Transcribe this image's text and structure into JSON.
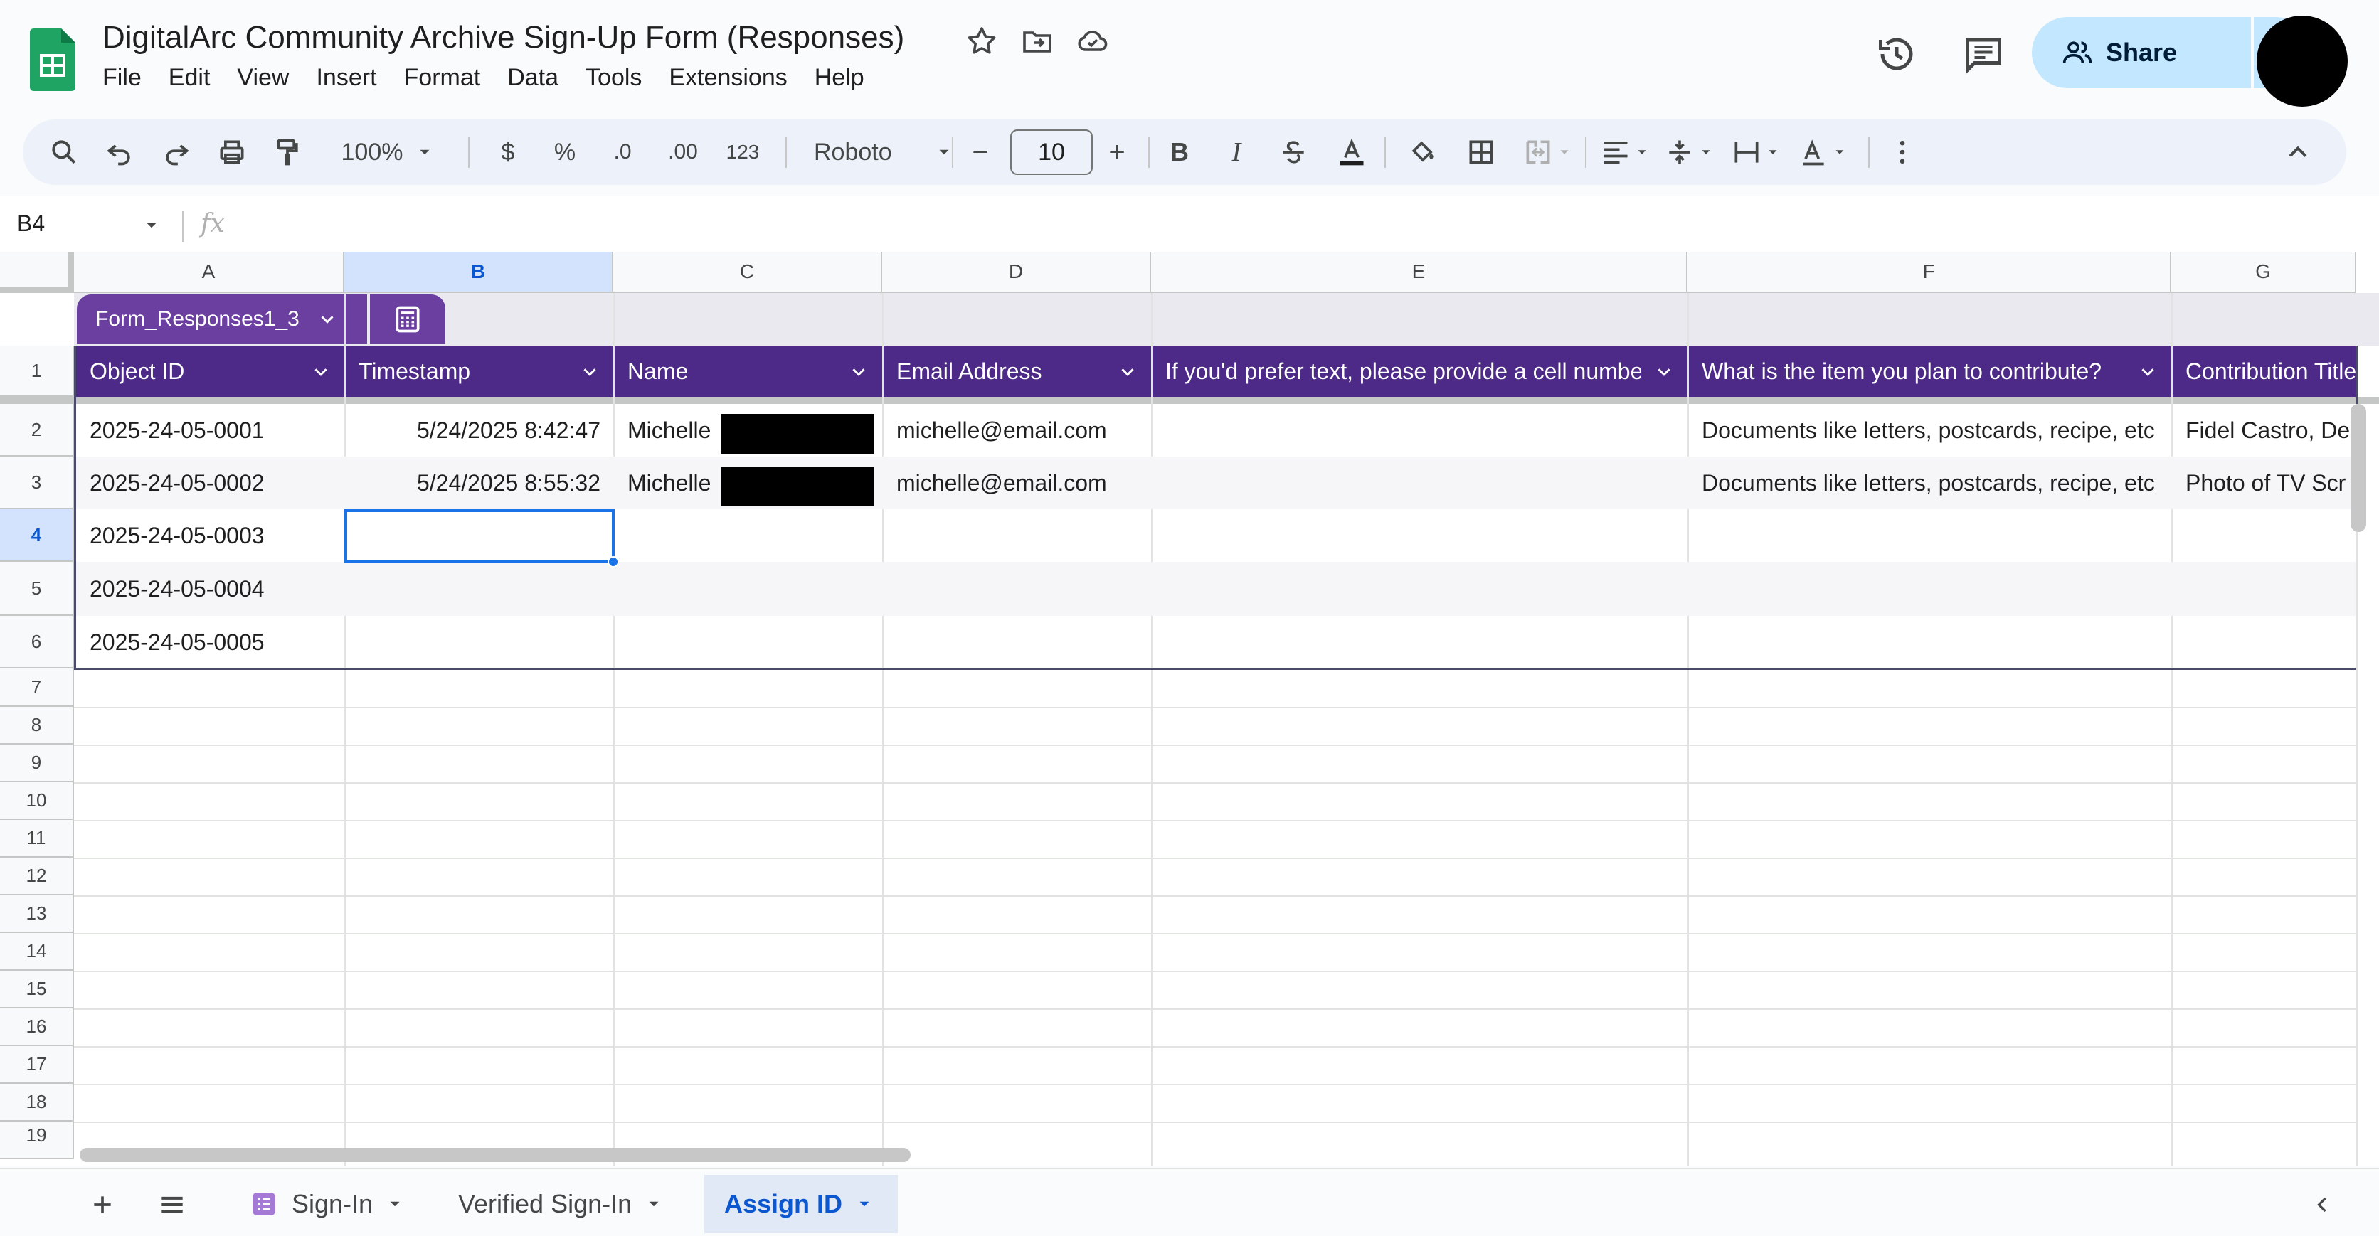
{
  "doc": {
    "title": "DigitalArc Community Archive Sign-Up Form  (Responses)",
    "menu": [
      "File",
      "Edit",
      "View",
      "Insert",
      "Format",
      "Data",
      "Tools",
      "Extensions",
      "Help"
    ],
    "share_label": "Share"
  },
  "toolbar": {
    "zoom": "100%",
    "currency": "$",
    "percent": "%",
    "dec_decrease": ".0",
    "dec_increase": ".00",
    "number_format": "123",
    "font": "Roboto",
    "font_size": "10",
    "minus": "−",
    "plus": "+",
    "bold": "B",
    "italic": "I"
  },
  "formula": {
    "cell_ref": "B4",
    "fx": "fx"
  },
  "columns": [
    "A",
    "B",
    "C",
    "D",
    "E",
    "F",
    "G"
  ],
  "rows": [
    "1",
    "2",
    "3",
    "4",
    "5",
    "6",
    "7",
    "8",
    "9",
    "10",
    "11",
    "12",
    "13",
    "14",
    "15",
    "16",
    "17",
    "18",
    "19"
  ],
  "table": {
    "name": "Form_Responses1_3",
    "headers": [
      "Object ID",
      "Timestamp",
      "Name",
      "Email Address",
      "If you'd prefer text, please provide a cell number",
      "What is the item you plan to contribute?",
      "Contribution Title"
    ],
    "rows": [
      [
        "2025-24-05-0001",
        "5/24/2025 8:42:47",
        "Michelle",
        "michelle@email.com",
        "",
        "Documents like letters, postcards, recipe, etc",
        "Fidel Castro, De"
      ],
      [
        "2025-24-05-0002",
        "5/24/2025 8:55:32",
        "Michelle",
        "michelle@email.com",
        "",
        "Documents like letters, postcards, recipe, etc",
        "Photo of TV Scr"
      ],
      [
        "2025-24-05-0003",
        "",
        "",
        "",
        "",
        "",
        ""
      ],
      [
        "2025-24-05-0004",
        "",
        "",
        "",
        "",
        "",
        ""
      ],
      [
        "2025-24-05-0005",
        "",
        "",
        "",
        "",
        "",
        ""
      ]
    ]
  },
  "sheets": {
    "tabs": [
      "Sign-In",
      "Verified Sign-In",
      "Assign ID"
    ],
    "active": "Assign ID"
  },
  "colors": {
    "table_header": "#4d2a87",
    "table_tab": "#6b3fa0",
    "selection": "#1a73e8",
    "share_bg": "#c2e7ff",
    "logo_green": "#1fa463"
  }
}
